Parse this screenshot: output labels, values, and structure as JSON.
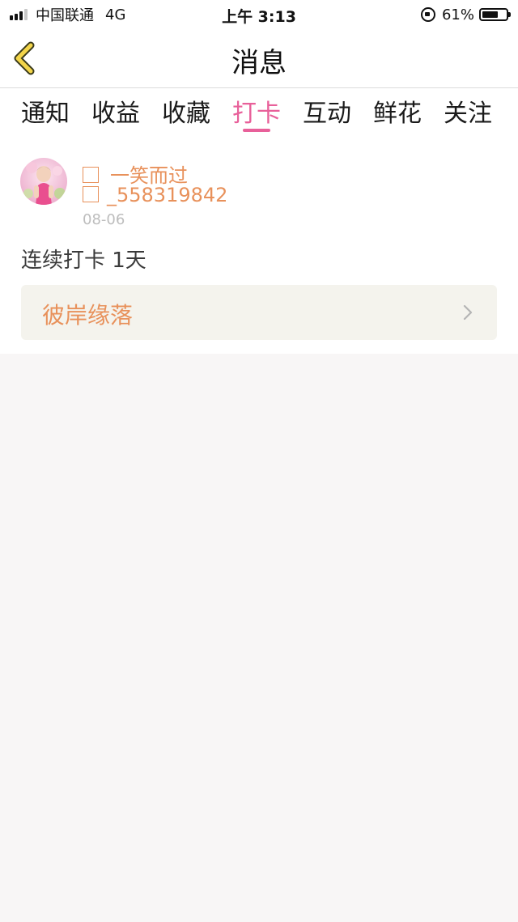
{
  "status_bar": {
    "carrier": "中国联通",
    "network": "4G",
    "time": "上午 3:13",
    "battery_percent": "61%",
    "signal_bars_active": 3,
    "signal_bars_total": 4,
    "battery_level": 0.61
  },
  "nav": {
    "back_icon": "chevron-left-icon",
    "title": "消息"
  },
  "tabs": [
    {
      "label": "通知",
      "active": false
    },
    {
      "label": "收益",
      "active": false
    },
    {
      "label": "收藏",
      "active": false
    },
    {
      "label": "打卡",
      "active": true
    },
    {
      "label": "互动",
      "active": false
    },
    {
      "label": "鲜花",
      "active": false
    },
    {
      "label": "关注",
      "active": false
    }
  ],
  "message": {
    "user_name_line1": "一笑而过",
    "user_name_line2": "_558319842",
    "date": "08-06",
    "checkin_text": "连续打卡 1天",
    "group_name": "彼岸缘落",
    "group_icon": "chevron-right-icon"
  },
  "colors": {
    "accent_pink": "#e8609a",
    "name_orange": "#e8915b",
    "card_bg": "#f4f3ed",
    "page_bg": "#f8f6f6"
  }
}
